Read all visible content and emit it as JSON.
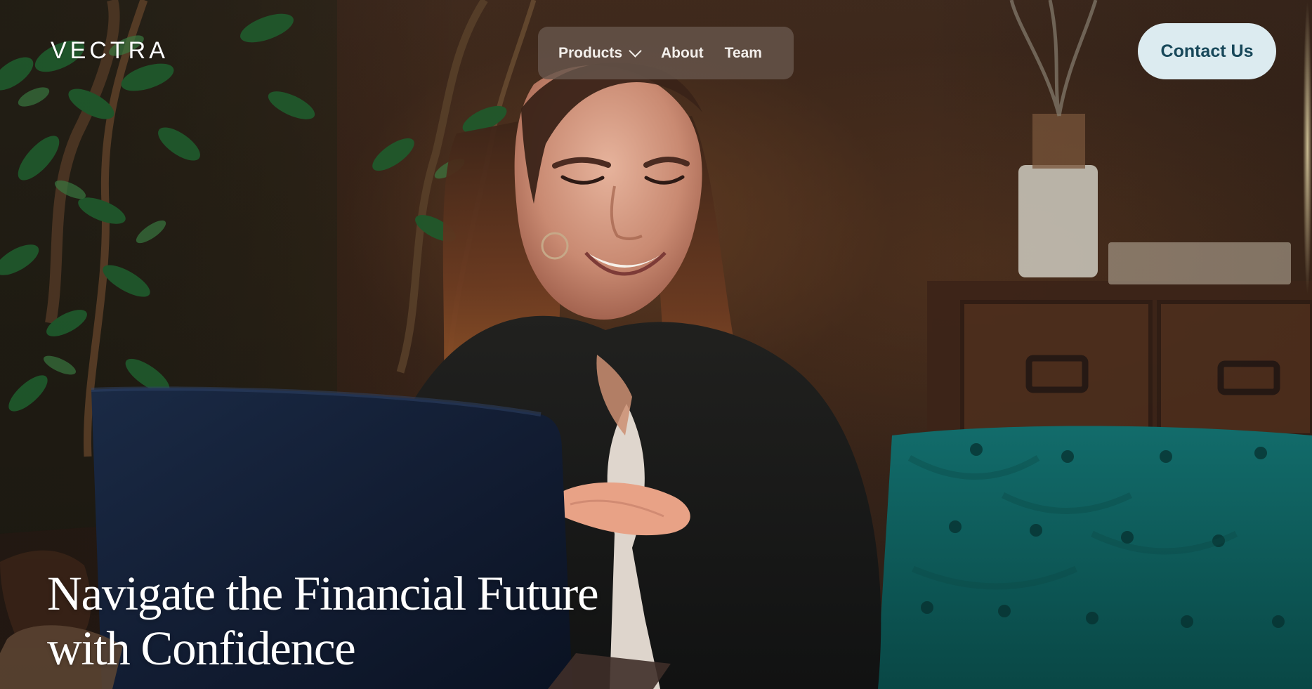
{
  "header": {
    "brand": "VECTRA",
    "nav": {
      "products_label": "Products",
      "about_label": "About",
      "team_label": "Team"
    },
    "contact_label": "Contact Us"
  },
  "hero": {
    "headline_line_1": "Navigate the Financial Future",
    "headline_line_2": "with Confidence"
  },
  "icons": {
    "products_dropdown": "chevron-down-icon"
  },
  "colors": {
    "contact_button_background": "#dcebf0",
    "contact_button_text": "#18485a",
    "nav_background": "#66564c",
    "sofa": "#0d5c5c",
    "laptop": "#17223a",
    "text": "#ffffff"
  }
}
